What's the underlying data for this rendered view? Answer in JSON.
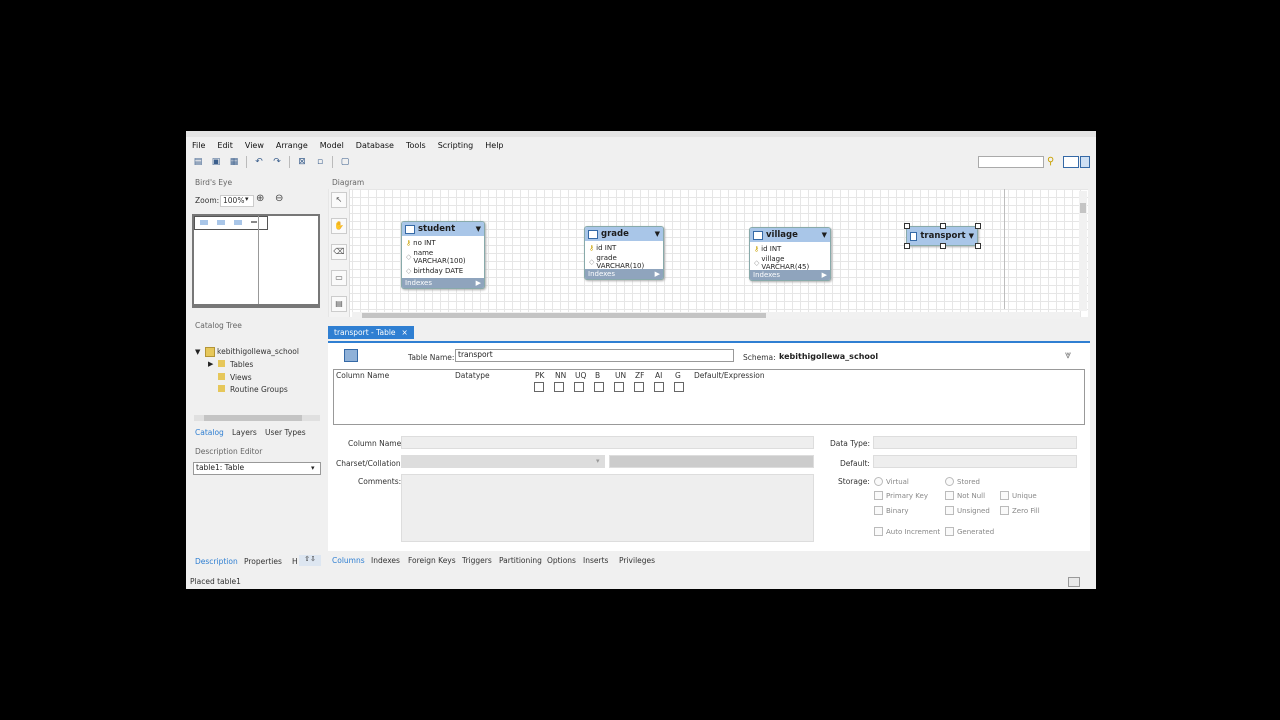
{
  "menubar": [
    "File",
    "Edit",
    "View",
    "Arrange",
    "Model",
    "Database",
    "Tools",
    "Scripting",
    "Help"
  ],
  "birds_eye": {
    "title": "Bird's Eye",
    "zoom_label": "Zoom:",
    "zoom_value": "100%"
  },
  "catalog": {
    "title": "Catalog Tree",
    "schema": "kebithigollewa_school",
    "items": [
      "Tables",
      "Views",
      "Routine Groups"
    ],
    "tabs": [
      "Catalog",
      "Layers",
      "User Types"
    ]
  },
  "description_editor": {
    "title": "Description Editor",
    "select_value": "table1: Table",
    "tabs": [
      "Description",
      "Properties",
      "H"
    ]
  },
  "diagram": {
    "title": "Diagram",
    "entities": [
      {
        "name": "student",
        "columns": [
          {
            "text": "no INT",
            "pk": true
          },
          {
            "text": "name VARCHAR(100)",
            "pk": false
          },
          {
            "text": "birthday DATE",
            "pk": false
          }
        ],
        "indexes_label": "Indexes"
      },
      {
        "name": "grade",
        "columns": [
          {
            "text": "id INT",
            "pk": true
          },
          {
            "text": "grade VARCHAR(10)",
            "pk": false
          }
        ],
        "indexes_label": "Indexes"
      },
      {
        "name": "village",
        "columns": [
          {
            "text": "id INT",
            "pk": true
          },
          {
            "text": "village VARCHAR(45)",
            "pk": false
          }
        ],
        "indexes_label": "Indexes"
      },
      {
        "name": "transport",
        "columns": [],
        "indexes_label": ""
      }
    ]
  },
  "editor": {
    "tab_label": "transport - Table",
    "table_name_label": "Table Name:",
    "table_name_value": "transport",
    "schema_label": "Schema:",
    "schema_value": "kebithigollewa_school",
    "grid_headers": {
      "column_name": "Column Name",
      "datatype": "Datatype",
      "flags": [
        "PK",
        "NN",
        "UQ",
        "B",
        "UN",
        "ZF",
        "AI",
        "G"
      ],
      "default": "Default/Expression"
    },
    "column_name_label": "Column Name:",
    "charset_label": "Charset/Collation:",
    "comments_label": "Comments:",
    "data_type_label": "Data Type:",
    "default_label": "Default:",
    "storage_label": "Storage:",
    "storage_options": [
      "Virtual",
      "Stored"
    ],
    "flag_options": [
      "Primary Key",
      "Not Null",
      "Unique",
      "Binary",
      "Unsigned",
      "Zero Fill",
      "Auto Increment",
      "Generated"
    ],
    "bottom_tabs": [
      "Columns",
      "Indexes",
      "Foreign Keys",
      "Triggers",
      "Partitioning",
      "Options",
      "Inserts",
      "Privileges"
    ]
  },
  "status": "Placed table1",
  "colors": {
    "accent": "#2f7fd2",
    "entity_header": "#a9c6e8"
  }
}
